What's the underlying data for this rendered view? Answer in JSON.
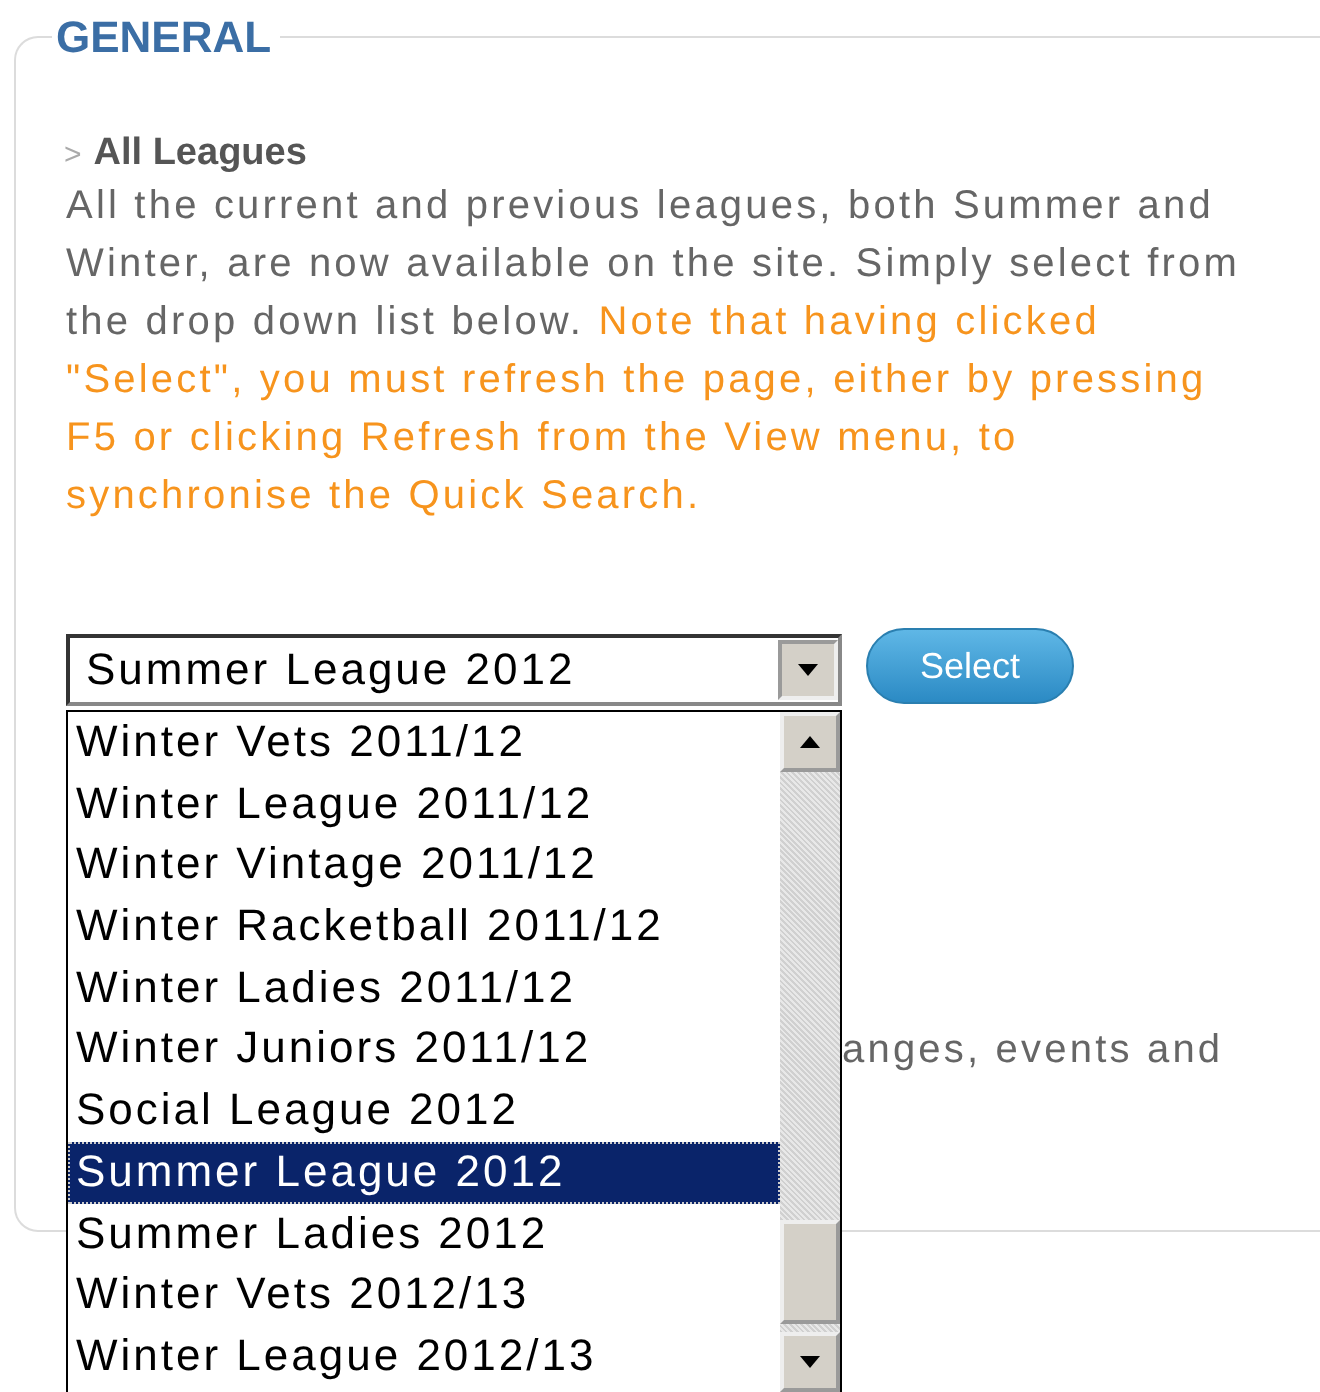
{
  "section": {
    "title": "GENERAL"
  },
  "article": {
    "heading": "All Leagues",
    "arrow": ">",
    "body": "All the current and previous leagues, both Summer and Winter, are now available on the site. Simply select from the drop down list below.",
    "note": "Note that having clicked \"Select\", you must refresh the page, either by pressing F5 or clicking Refresh from the View menu, to synchronise the Quick Search."
  },
  "league_select": {
    "value": "Summer League 2012",
    "expanded": true,
    "button": "Select",
    "options": [
      {
        "label": "Winter Vets 2011/12",
        "selected": false
      },
      {
        "label": "Winter League 2011/12",
        "selected": false
      },
      {
        "label": "Winter Vintage 2011/12",
        "selected": false
      },
      {
        "label": "Winter Racketball 2011/12",
        "selected": false
      },
      {
        "label": "Winter Ladies 2011/12",
        "selected": false
      },
      {
        "label": "Winter Juniors 2011/12",
        "selected": false
      },
      {
        "label": "Social League 2012",
        "selected": false
      },
      {
        "label": "Summer League 2012",
        "selected": true
      },
      {
        "label": "Summer Ladies 2012",
        "selected": false
      },
      {
        "label": "Winter Vets 2012/13",
        "selected": false
      },
      {
        "label": "Winter League 2012/13",
        "selected": false
      }
    ]
  },
  "partial_text": "anges, events and"
}
